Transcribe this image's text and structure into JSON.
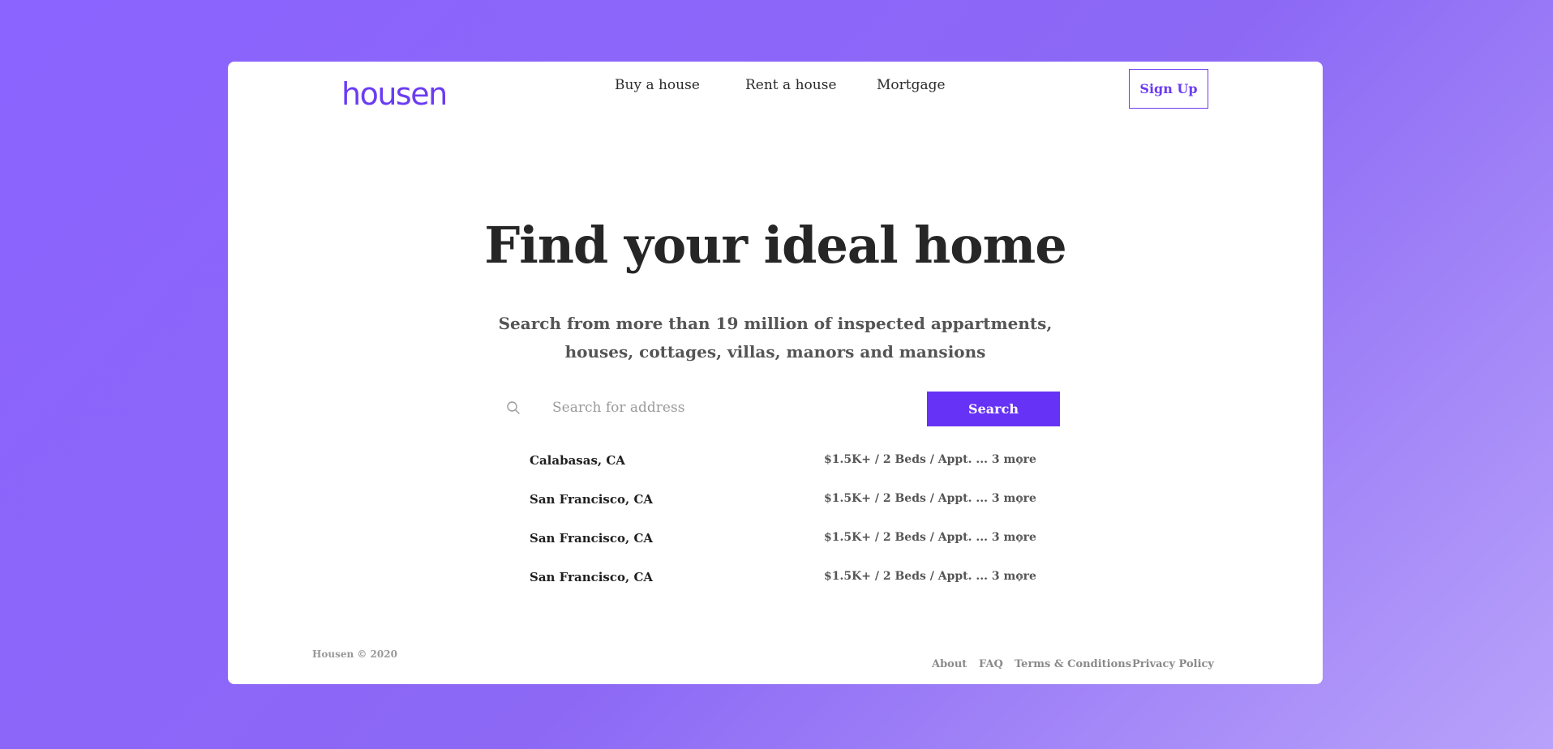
{
  "brand": {
    "logo_text": "housen",
    "accent_color": "#6632f5"
  },
  "nav": {
    "items": [
      {
        "label": "Buy a house"
      },
      {
        "label": "Rent a house"
      },
      {
        "label": "Mortgage"
      }
    ],
    "signup_label": "Sign Up"
  },
  "hero": {
    "title": "Find your ideal home",
    "subtitle_line1": "Search from more than 19 million of inspected appartments,",
    "subtitle_line2": "houses, cottages, villas, manors and mansions"
  },
  "search": {
    "icon": "search-icon",
    "placeholder": "Search for address",
    "value": "",
    "button_label": "Search"
  },
  "results": [
    {
      "city": "Calabasas, CA",
      "meta": "$1.5K+ / 2 Beds / Appt. ... 3 more"
    },
    {
      "city": "San Francisco, CA",
      "meta": "$1.5K+ / 2 Beds / Appt. ... 3 more"
    },
    {
      "city": "San Francisco, CA",
      "meta": "$1.5K+ / 2 Beds / Appt. ... 3 more"
    },
    {
      "city": "San Francisco, CA",
      "meta": "$1.5K+ / 2 Beds / Appt. ... 3 more"
    }
  ],
  "footer": {
    "copyright": "Housen © 2020",
    "links": [
      {
        "label": "About"
      },
      {
        "label": "FAQ"
      },
      {
        "label": "Terms & Conditions"
      },
      {
        "label": "Privacy Policy"
      }
    ]
  }
}
